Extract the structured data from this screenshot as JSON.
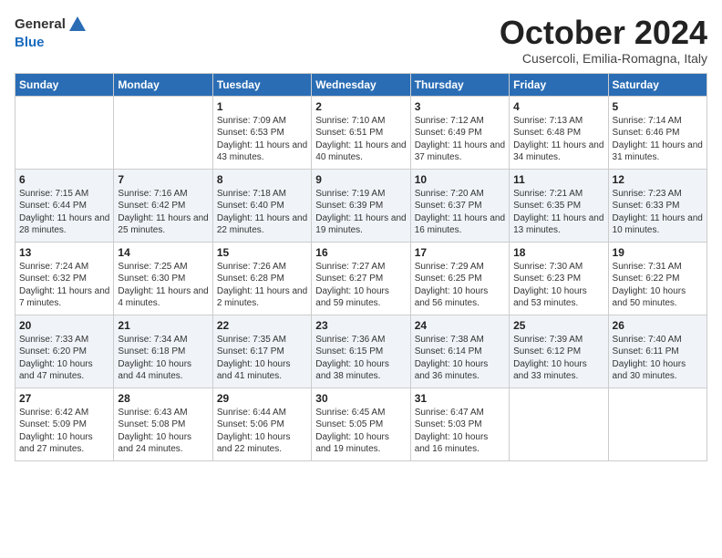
{
  "header": {
    "logo_line1": "General",
    "logo_line2": "Blue",
    "month": "October 2024",
    "location": "Cusercoli, Emilia-Romagna, Italy"
  },
  "days_of_week": [
    "Sunday",
    "Monday",
    "Tuesday",
    "Wednesday",
    "Thursday",
    "Friday",
    "Saturday"
  ],
  "weeks": [
    [
      {
        "day": null
      },
      {
        "day": null
      },
      {
        "day": "1",
        "sunrise": "Sunrise: 7:09 AM",
        "sunset": "Sunset: 6:53 PM",
        "daylight": "Daylight: 11 hours and 43 minutes."
      },
      {
        "day": "2",
        "sunrise": "Sunrise: 7:10 AM",
        "sunset": "Sunset: 6:51 PM",
        "daylight": "Daylight: 11 hours and 40 minutes."
      },
      {
        "day": "3",
        "sunrise": "Sunrise: 7:12 AM",
        "sunset": "Sunset: 6:49 PM",
        "daylight": "Daylight: 11 hours and 37 minutes."
      },
      {
        "day": "4",
        "sunrise": "Sunrise: 7:13 AM",
        "sunset": "Sunset: 6:48 PM",
        "daylight": "Daylight: 11 hours and 34 minutes."
      },
      {
        "day": "5",
        "sunrise": "Sunrise: 7:14 AM",
        "sunset": "Sunset: 6:46 PM",
        "daylight": "Daylight: 11 hours and 31 minutes."
      }
    ],
    [
      {
        "day": "6",
        "sunrise": "Sunrise: 7:15 AM",
        "sunset": "Sunset: 6:44 PM",
        "daylight": "Daylight: 11 hours and 28 minutes."
      },
      {
        "day": "7",
        "sunrise": "Sunrise: 7:16 AM",
        "sunset": "Sunset: 6:42 PM",
        "daylight": "Daylight: 11 hours and 25 minutes."
      },
      {
        "day": "8",
        "sunrise": "Sunrise: 7:18 AM",
        "sunset": "Sunset: 6:40 PM",
        "daylight": "Daylight: 11 hours and 22 minutes."
      },
      {
        "day": "9",
        "sunrise": "Sunrise: 7:19 AM",
        "sunset": "Sunset: 6:39 PM",
        "daylight": "Daylight: 11 hours and 19 minutes."
      },
      {
        "day": "10",
        "sunrise": "Sunrise: 7:20 AM",
        "sunset": "Sunset: 6:37 PM",
        "daylight": "Daylight: 11 hours and 16 minutes."
      },
      {
        "day": "11",
        "sunrise": "Sunrise: 7:21 AM",
        "sunset": "Sunset: 6:35 PM",
        "daylight": "Daylight: 11 hours and 13 minutes."
      },
      {
        "day": "12",
        "sunrise": "Sunrise: 7:23 AM",
        "sunset": "Sunset: 6:33 PM",
        "daylight": "Daylight: 11 hours and 10 minutes."
      }
    ],
    [
      {
        "day": "13",
        "sunrise": "Sunrise: 7:24 AM",
        "sunset": "Sunset: 6:32 PM",
        "daylight": "Daylight: 11 hours and 7 minutes."
      },
      {
        "day": "14",
        "sunrise": "Sunrise: 7:25 AM",
        "sunset": "Sunset: 6:30 PM",
        "daylight": "Daylight: 11 hours and 4 minutes."
      },
      {
        "day": "15",
        "sunrise": "Sunrise: 7:26 AM",
        "sunset": "Sunset: 6:28 PM",
        "daylight": "Daylight: 11 hours and 2 minutes."
      },
      {
        "day": "16",
        "sunrise": "Sunrise: 7:27 AM",
        "sunset": "Sunset: 6:27 PM",
        "daylight": "Daylight: 10 hours and 59 minutes."
      },
      {
        "day": "17",
        "sunrise": "Sunrise: 7:29 AM",
        "sunset": "Sunset: 6:25 PM",
        "daylight": "Daylight: 10 hours and 56 minutes."
      },
      {
        "day": "18",
        "sunrise": "Sunrise: 7:30 AM",
        "sunset": "Sunset: 6:23 PM",
        "daylight": "Daylight: 10 hours and 53 minutes."
      },
      {
        "day": "19",
        "sunrise": "Sunrise: 7:31 AM",
        "sunset": "Sunset: 6:22 PM",
        "daylight": "Daylight: 10 hours and 50 minutes."
      }
    ],
    [
      {
        "day": "20",
        "sunrise": "Sunrise: 7:33 AM",
        "sunset": "Sunset: 6:20 PM",
        "daylight": "Daylight: 10 hours and 47 minutes."
      },
      {
        "day": "21",
        "sunrise": "Sunrise: 7:34 AM",
        "sunset": "Sunset: 6:18 PM",
        "daylight": "Daylight: 10 hours and 44 minutes."
      },
      {
        "day": "22",
        "sunrise": "Sunrise: 7:35 AM",
        "sunset": "Sunset: 6:17 PM",
        "daylight": "Daylight: 10 hours and 41 minutes."
      },
      {
        "day": "23",
        "sunrise": "Sunrise: 7:36 AM",
        "sunset": "Sunset: 6:15 PM",
        "daylight": "Daylight: 10 hours and 38 minutes."
      },
      {
        "day": "24",
        "sunrise": "Sunrise: 7:38 AM",
        "sunset": "Sunset: 6:14 PM",
        "daylight": "Daylight: 10 hours and 36 minutes."
      },
      {
        "day": "25",
        "sunrise": "Sunrise: 7:39 AM",
        "sunset": "Sunset: 6:12 PM",
        "daylight": "Daylight: 10 hours and 33 minutes."
      },
      {
        "day": "26",
        "sunrise": "Sunrise: 7:40 AM",
        "sunset": "Sunset: 6:11 PM",
        "daylight": "Daylight: 10 hours and 30 minutes."
      }
    ],
    [
      {
        "day": "27",
        "sunrise": "Sunrise: 6:42 AM",
        "sunset": "Sunset: 5:09 PM",
        "daylight": "Daylight: 10 hours and 27 minutes."
      },
      {
        "day": "28",
        "sunrise": "Sunrise: 6:43 AM",
        "sunset": "Sunset: 5:08 PM",
        "daylight": "Daylight: 10 hours and 24 minutes."
      },
      {
        "day": "29",
        "sunrise": "Sunrise: 6:44 AM",
        "sunset": "Sunset: 5:06 PM",
        "daylight": "Daylight: 10 hours and 22 minutes."
      },
      {
        "day": "30",
        "sunrise": "Sunrise: 6:45 AM",
        "sunset": "Sunset: 5:05 PM",
        "daylight": "Daylight: 10 hours and 19 minutes."
      },
      {
        "day": "31",
        "sunrise": "Sunrise: 6:47 AM",
        "sunset": "Sunset: 5:03 PM",
        "daylight": "Daylight: 10 hours and 16 minutes."
      },
      {
        "day": null
      },
      {
        "day": null
      }
    ]
  ]
}
